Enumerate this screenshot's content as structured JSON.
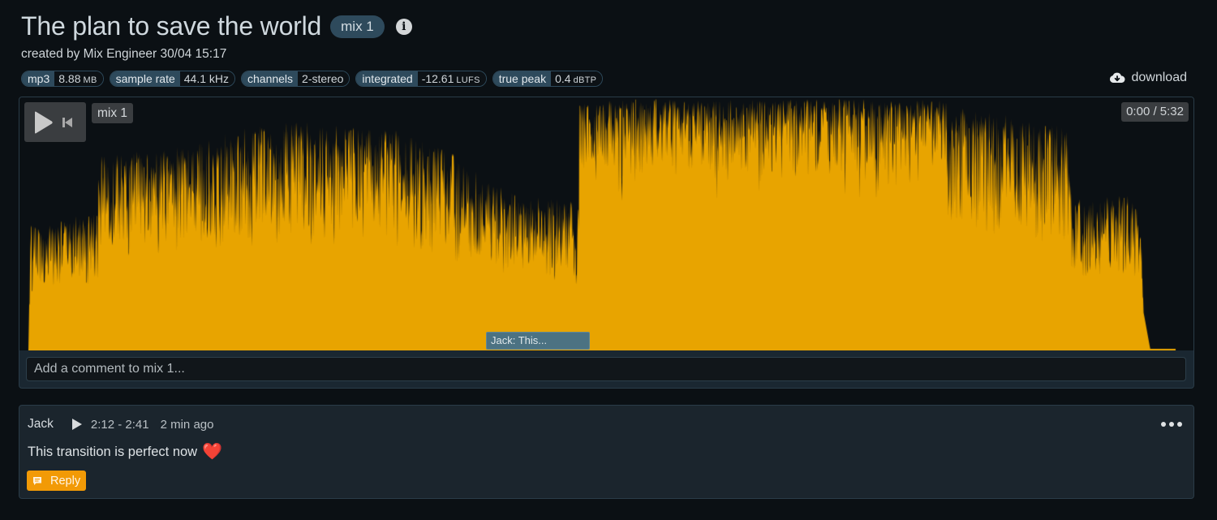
{
  "header": {
    "title": "The plan to save the world",
    "mix_badge": "mix 1",
    "info_icon": "info-circle-icon",
    "subtitle": "created by Mix Engineer 30/04 15:17"
  },
  "file_info": [
    {
      "key": "mp3",
      "value": "8.88",
      "unit": "MB"
    },
    {
      "key": "sample rate",
      "value": "44.1 kHz",
      "unit": ""
    },
    {
      "key": "channels",
      "value": "2-stereo",
      "unit": ""
    },
    {
      "key": "integrated",
      "value": "-12.61",
      "unit": "LUFS"
    },
    {
      "key": "true peak",
      "value": "0.4",
      "unit": "dBTP"
    }
  ],
  "download": {
    "label": "download",
    "icon": "cloud-download-icon"
  },
  "player": {
    "track_label": "mix 1",
    "time": "0:00 / 5:32",
    "current_time": "0:00",
    "duration": "5:32",
    "play_icon": "play-icon",
    "restart_icon": "skip-to-start-icon",
    "waveform_color": "#e8a400",
    "waveform_envelope": [
      [
        0.0,
        0.0
      ],
      [
        0.002,
        0.5
      ],
      [
        0.06,
        0.55
      ],
      [
        0.062,
        0.78
      ],
      [
        0.1,
        0.8
      ],
      [
        0.14,
        0.82
      ],
      [
        0.19,
        0.9
      ],
      [
        0.24,
        0.92
      ],
      [
        0.27,
        0.9
      ],
      [
        0.32,
        0.88
      ],
      [
        0.36,
        0.82
      ],
      [
        0.395,
        0.7
      ],
      [
        0.43,
        0.62
      ],
      [
        0.474,
        0.6
      ],
      [
        0.478,
        0.35
      ],
      [
        0.48,
        1.0
      ],
      [
        0.6,
        1.0
      ],
      [
        0.7,
        1.0
      ],
      [
        0.8,
        0.98
      ],
      [
        0.88,
        0.92
      ],
      [
        0.905,
        0.9
      ],
      [
        0.91,
        0.6
      ],
      [
        0.96,
        0.62
      ],
      [
        0.97,
        0.55
      ],
      [
        0.972,
        0.15
      ],
      [
        0.978,
        0.0
      ],
      [
        1.0,
        0.0
      ]
    ],
    "comment_marker": {
      "label": "Jack: This...",
      "start": "2:12",
      "end": "2:41"
    },
    "comment_placeholder": "Add a comment to mix 1..."
  },
  "comments": [
    {
      "author": "Jack",
      "range": "2:12 - 2:41",
      "ago": "2 min ago",
      "text": "This transition is perfect now",
      "emoji": "❤️",
      "reply_label": "Reply",
      "more_icon": "more-horizontal-icon"
    }
  ],
  "colors": {
    "background": "#0b1014",
    "accent": "#f29a06",
    "pill": "#2e4a5c",
    "waveform": "#e8a400"
  }
}
